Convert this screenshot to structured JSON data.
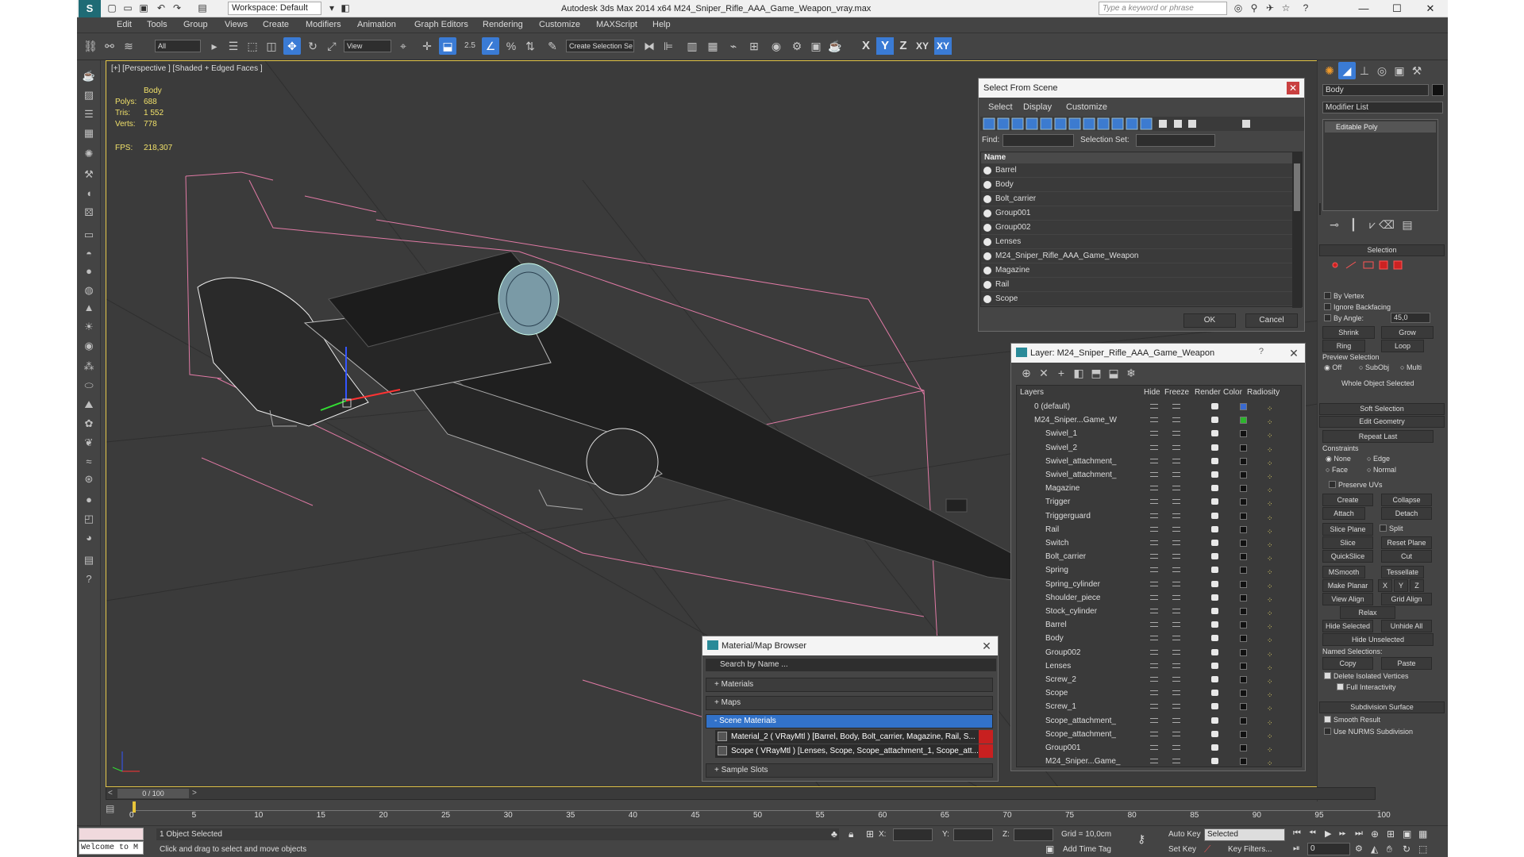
{
  "titlebar": {
    "workspace": "Workspace: Default",
    "title": "Autodesk 3ds Max  2014 x64      M24_Sniper_Rifle_AAA_Game_Weapon_vray.max",
    "search_placeholder": "Type a keyword or phrase",
    "minimize": "—",
    "maximize": "☐",
    "close": "✕"
  },
  "menubar": [
    "Edit",
    "Tools",
    "Group",
    "Views",
    "Create",
    "Modifiers",
    "Animation",
    "Graph Editors",
    "Rendering",
    "Customize",
    "MAXScript",
    "Help"
  ],
  "toolbar": {
    "filter_select": "All",
    "refcoord_select": "View",
    "snap_label": "2.5",
    "selection_set_placeholder": "Create Selection Se",
    "axes": [
      "X",
      "Y",
      "Z",
      "XY",
      "XY"
    ]
  },
  "viewport": {
    "label": "[+] [Perspective ] [Shaded + Edged Faces ]",
    "stats": {
      "object": "Body",
      "polys_label": "Polys:",
      "polys": "688",
      "tris_label": "Tris:",
      "tris": "1 552",
      "verts_label": "Verts:",
      "verts": "778",
      "fps_label": "FPS:",
      "fps": "218,307"
    }
  },
  "select_from_scene": {
    "title": "Select From Scene",
    "close": "✕",
    "tabs": [
      "Select",
      "Display",
      "Customize"
    ],
    "find_label": "Find:",
    "selset_label": "Selection Set:",
    "column_name": "Name",
    "items": [
      "Barrel",
      "Body",
      "Bolt_carrier",
      "Group001",
      "Group002",
      "Lenses",
      "M24_Sniper_Rifle_AAA_Game_Weapon",
      "Magazine",
      "Rail",
      "Scope"
    ],
    "ok": "OK",
    "cancel": "Cancel"
  },
  "layer_dialog": {
    "title": "Layer: M24_Sniper_Rifle_AAA_Game_Weapon",
    "help": "?",
    "close": "✕",
    "columns": [
      "Layers",
      "Hide",
      "Freeze",
      "Render",
      "Color",
      "Radiosity"
    ],
    "top_layers": [
      "0 (default)",
      "M24_Sniper...Game_W"
    ],
    "objects": [
      "Swivel_1",
      "Swivel_2",
      "Swivel_attachment_",
      "Swivel_attachment_",
      "Magazine",
      "Trigger",
      "Triggerguard",
      "Rail",
      "Switch",
      "Bolt_carrier",
      "Spring",
      "Spring_cylinder",
      "Shoulder_piece",
      "Stock_cylinder",
      "Barrel",
      "Body",
      "Group002",
      "Lenses",
      "Screw_2",
      "Scope",
      "Screw_1",
      "Scope_attachment_",
      "Scope_attachment_",
      "Group001",
      "M24_Sniper...Game_"
    ]
  },
  "material_browser": {
    "title": "Material/Map Browser",
    "close": "✕",
    "search": "Search by Name ...",
    "rollouts": [
      "+ Materials",
      "+ Maps",
      "- Scene Materials",
      "+ Sample Slots"
    ],
    "materials": [
      "Material_2  ( VRayMtl )  [Barrel, Body, Bolt_carrier, Magazine, Rail, S...",
      "Scope  ( VRayMtl )  [Lenses, Scope, Scope_attachment_1, Scope_att..."
    ]
  },
  "command_panel": {
    "object_name": "Body",
    "modifier_list": "Modifier List",
    "stack_item": "Editable Poly",
    "selection_title": "Selection",
    "by_vertex": "By Vertex",
    "ignore_backfacing": "Ignore Backfacing",
    "by_angle": "By Angle:",
    "angle_value": "45,0",
    "shrink": "Shrink",
    "grow": "Grow",
    "ring": "Ring",
    "loop": "Loop",
    "preview_selection": "Preview Selection",
    "off": "Off",
    "subobj": "SubObj",
    "multi": "Multi",
    "whole_object": "Whole Object Selected",
    "soft_selection": "Soft Selection",
    "edit_geometry": "Edit Geometry",
    "repeat_last": "Repeat Last",
    "constraints": "Constraints",
    "none": "None",
    "edge": "Edge",
    "face": "Face",
    "normal": "Normal",
    "preserve_uvs": "Preserve UVs",
    "create": "Create",
    "collapse": "Collapse",
    "attach": "Attach",
    "detach": "Detach",
    "slice_plane": "Slice Plane",
    "split": "Split",
    "slice": "Slice",
    "reset_plane": "Reset Plane",
    "quickslice": "QuickSlice",
    "cut": "Cut",
    "msmooth": "MSmooth",
    "tessellate": "Tessellate",
    "make_planar": "Make Planar",
    "x": "X",
    "y": "Y",
    "z": "Z",
    "view_align": "View Align",
    "grid_align": "Grid Align",
    "relax": "Relax",
    "hide_selected": "Hide Selected",
    "unhide_all": "Unhide All",
    "hide_unselected": "Hide Unselected",
    "named_selections": "Named Selections:",
    "copy": "Copy",
    "paste": "Paste",
    "delete_isolated": "Delete Isolated Vertices",
    "full_interactivity": "Full Interactivity",
    "subdivision_surface": "Subdivision Surface",
    "smooth_result": "Smooth Result",
    "use_nurms": "Use NURMS Subdivision"
  },
  "timeline": {
    "frame": "0 / 100",
    "ticks": [
      "0",
      "5",
      "10",
      "15",
      "20",
      "25",
      "30",
      "35",
      "40",
      "45",
      "50",
      "55",
      "60",
      "65",
      "70",
      "75",
      "80",
      "85",
      "90",
      "95",
      "100"
    ]
  },
  "statusbar": {
    "maxscript": "Welcome to M",
    "selected": "1 Object Selected",
    "prompt": "Click and drag to select and move objects",
    "x_label": "X:",
    "y_label": "Y:",
    "z_label": "Z:",
    "grid": "Grid = 10,0cm",
    "add_time_tag": "Add Time Tag",
    "auto_key": "Auto Key",
    "set_key": "Set Key",
    "selected_dropdown": "Selected",
    "key_filters": "Key Filters...",
    "frame_field": "0"
  }
}
